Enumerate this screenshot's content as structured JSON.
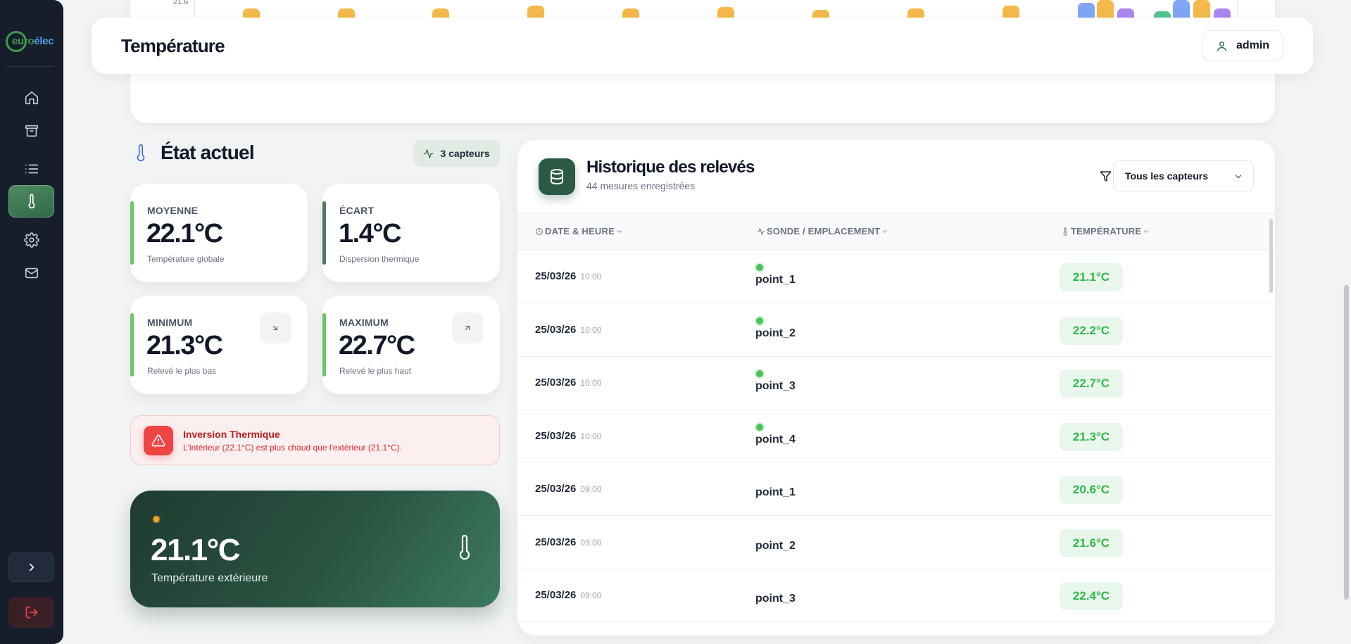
{
  "sidebar": {
    "logo_text": "euro",
    "logo_accent": "élec",
    "nav_items": [
      {
        "icon": "home-icon"
      },
      {
        "icon": "archive-icon"
      },
      {
        "icon": "list-icon"
      },
      {
        "icon": "thermometer-icon",
        "active": true
      },
      {
        "icon": "gear-icon"
      },
      {
        "icon": "mail-icon"
      }
    ],
    "expand_icon": "chevron-right-icon",
    "logout_icon": "logout-icon"
  },
  "chart": {
    "y_tick": "21.6",
    "bar_colors": {
      "orange": "#f4b94a",
      "blue": "#7fa6f5",
      "purple": "#ad86f2",
      "green": "#52c491"
    }
  },
  "header": {
    "title": "Température",
    "user_label": "admin"
  },
  "etat": {
    "title": "État actuel",
    "badge_label": "3 capteurs",
    "cards": {
      "moyenne": {
        "label": "MOYENNE",
        "value": "22.1°C",
        "sub": "Température globale"
      },
      "ecart": {
        "label": "ÉCART",
        "value": "1.4°C",
        "sub": "Dispersion thermique"
      },
      "minimum": {
        "label": "MINIMUM",
        "value": "21.3°C",
        "sub": "Relevé le plus bas"
      },
      "maximum": {
        "label": "MAXIMUM",
        "value": "22.7°C",
        "sub": "Relevé le plus haut"
      }
    }
  },
  "alert": {
    "title": "Inversion Thermique",
    "text": "L'intérieur (22.1°C) est plus chaud que l'extérieur (21.1°C)."
  },
  "exterior": {
    "value": "21.1°C",
    "label": "Température extérieure"
  },
  "history": {
    "title": "Historique des relevés",
    "subtitle": "44 mesures enregistrées",
    "filter_value": "Tous les capteurs",
    "columns": {
      "date": "DATE & HEURE",
      "sensor": "SONDE / EMPLACEMENT",
      "temp": "TEMPÉRATURE"
    },
    "rows": [
      {
        "date": "25/03/26",
        "time": "10:00",
        "sensor": "point_1",
        "temp": "21.1°C",
        "online": true
      },
      {
        "date": "25/03/26",
        "time": "10:00",
        "sensor": "point_2",
        "temp": "22.2°C",
        "online": true
      },
      {
        "date": "25/03/26",
        "time": "10:00",
        "sensor": "point_3",
        "temp": "22.7°C",
        "online": true
      },
      {
        "date": "25/03/26",
        "time": "10:00",
        "sensor": "point_4",
        "temp": "21.3°C",
        "online": true
      },
      {
        "date": "25/03/26",
        "time": "09:00",
        "sensor": "point_1",
        "temp": "20.6°C",
        "online": false
      },
      {
        "date": "25/03/26",
        "time": "09:00",
        "sensor": "point_2",
        "temp": "21.6°C",
        "online": false
      },
      {
        "date": "25/03/26",
        "time": "09:00",
        "sensor": "point_3",
        "temp": "22.4°C",
        "online": false
      }
    ]
  }
}
